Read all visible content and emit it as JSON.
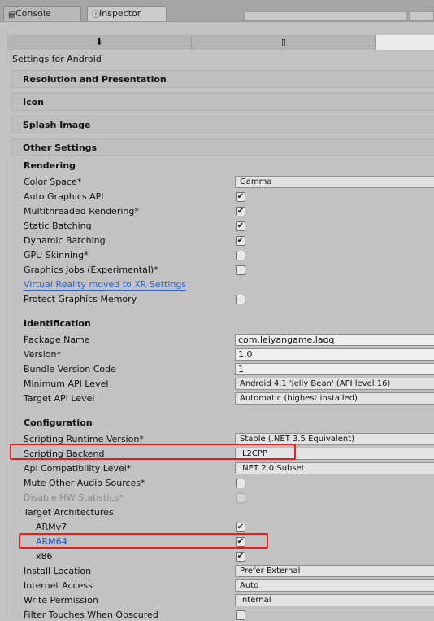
{
  "tabs": [
    {
      "label": "Console",
      "icon": "console-icon"
    },
    {
      "label": "Inspector",
      "icon": "info-icon"
    }
  ],
  "platform_tabs": [
    {
      "icon": "download-icon",
      "glyph": "⬇"
    },
    {
      "icon": "mobile-phone-icon",
      "glyph": "▯"
    },
    {
      "icon": "blank-tab",
      "glyph": ""
    }
  ],
  "settings_title": "Settings for Android",
  "sections": {
    "resolution": "Resolution and Presentation",
    "icon": "Icon",
    "splash": "Splash Image",
    "other": "Other Settings"
  },
  "rendering": {
    "header": "Rendering",
    "color_space": {
      "label": "Color Space*",
      "value": "Gamma"
    },
    "auto_graphics_api": {
      "label": "Auto Graphics API",
      "checked": true
    },
    "multithreaded": {
      "label": "Multithreaded Rendering*",
      "checked": true
    },
    "static_batching": {
      "label": "Static Batching",
      "checked": true
    },
    "dynamic_batching": {
      "label": "Dynamic Batching",
      "checked": true
    },
    "gpu_skinning": {
      "label": "GPU Skinning*",
      "checked": false
    },
    "graphics_jobs": {
      "label": "Graphics Jobs (Experimental)*",
      "checked": false
    },
    "vr_link": "Virtual Reality moved to XR Settings",
    "protect_memory": {
      "label": "Protect Graphics Memory",
      "checked": false
    }
  },
  "identification": {
    "header": "Identification",
    "package_name": {
      "label": "Package Name",
      "value": "com.leiyangame.laoq"
    },
    "version": {
      "label": "Version*",
      "value": "1.0"
    },
    "bundle_code": {
      "label": "Bundle Version Code",
      "value": "1"
    },
    "min_api": {
      "label": "Minimum API Level",
      "value": "Android 4.1 'Jelly Bean' (API level 16)"
    },
    "target_api": {
      "label": "Target API Level",
      "value": "Automatic (highest installed)"
    }
  },
  "configuration": {
    "header": "Configuration",
    "runtime_version": {
      "label": "Scripting Runtime Version*",
      "value": "Stable (.NET 3.5 Equivalent)"
    },
    "scripting_backend": {
      "label": "Scripting Backend",
      "value": "IL2CPP"
    },
    "api_compat": {
      "label": "Api Compatibility Level*",
      "value": ".NET 2.0 Subset"
    },
    "mute_audio": {
      "label": "Mute Other Audio Sources*",
      "checked": false
    },
    "disable_hw_stats": {
      "label": "Disable HW Statistics*",
      "checked": false
    },
    "target_arch": {
      "label": "Target Architectures"
    },
    "armv7": {
      "label": "ARMv7",
      "checked": true
    },
    "arm64": {
      "label": "ARM64",
      "checked": true
    },
    "x86": {
      "label": "x86",
      "checked": true
    },
    "install_location": {
      "label": "Install Location",
      "value": "Prefer External"
    },
    "internet_access": {
      "label": "Internet Access",
      "value": "Auto"
    },
    "write_permission": {
      "label": "Write Permission",
      "value": "Internal"
    },
    "filter_touches": {
      "label": "Filter Touches When Obscured",
      "checked": false
    }
  },
  "colors": {
    "highlight_box": "#e51d1d",
    "link": "#2a5fd6",
    "arm64_label": "#1e4fb8"
  },
  "check_glyph": "✔"
}
